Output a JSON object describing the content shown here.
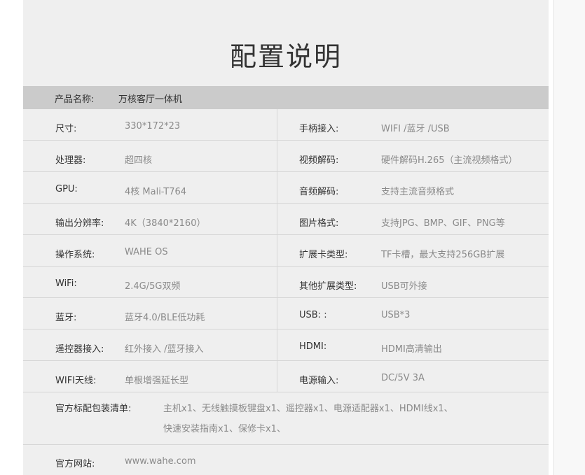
{
  "title": "配置说明",
  "product": {
    "label": "产品名称:",
    "value": "万核客厅一体机"
  },
  "specs": [
    {
      "left_label": "尺寸:",
      "left_value": "330*172*23",
      "right_label": "手柄接入:",
      "right_value": "WIFI /蓝牙 /USB"
    },
    {
      "left_label": "处理器:",
      "left_value": "超四核",
      "right_label": "视频解码:",
      "right_value": "硬件解码H.265（主流视频格式）"
    },
    {
      "left_label": "GPU:",
      "left_value": "4核  Mali-T764",
      "right_label": "音频解码:",
      "right_value": "支持主流音频格式"
    },
    {
      "left_label": "输出分辨率:",
      "left_value": "4K（3840*2160）",
      "right_label": "图片格式:",
      "right_value": "支持JPG、BMP、GIF、PNG等"
    },
    {
      "left_label": "操作系统:",
      "left_value": "WAHE OS",
      "right_label": "扩展卡类型:",
      "right_value": "TF卡槽，最大支持256GB扩展"
    },
    {
      "left_label": "WiFi:",
      "left_value": "2.4G/5G双频",
      "right_label": "其他扩展类型:",
      "right_value": "USB可外接"
    },
    {
      "left_label": "蓝牙:",
      "left_value": "蓝牙4.0/BLE低功耗",
      "right_label": "USB: :",
      "right_value": "USB*3"
    },
    {
      "left_label": "遥控器接入:",
      "left_value": "红外接入 /蓝牙接入",
      "right_label": "HDMI:",
      "right_value": "HDMI高清输出"
    },
    {
      "left_label": "WIFI天线:",
      "left_value": "单根增强延长型",
      "right_label": "电源输入:",
      "right_value": "DC/5V 3A"
    }
  ],
  "package": {
    "label": "官方标配包装清单:",
    "line1": "主机x1、无线触摸板键盘x1、遥控器x1、电源适配器x1、HDMI线x1、",
    "line2": "快速安装指南x1、保修卡x1、"
  },
  "website": {
    "label": "官方网站:",
    "value": "www.wahe.com"
  }
}
